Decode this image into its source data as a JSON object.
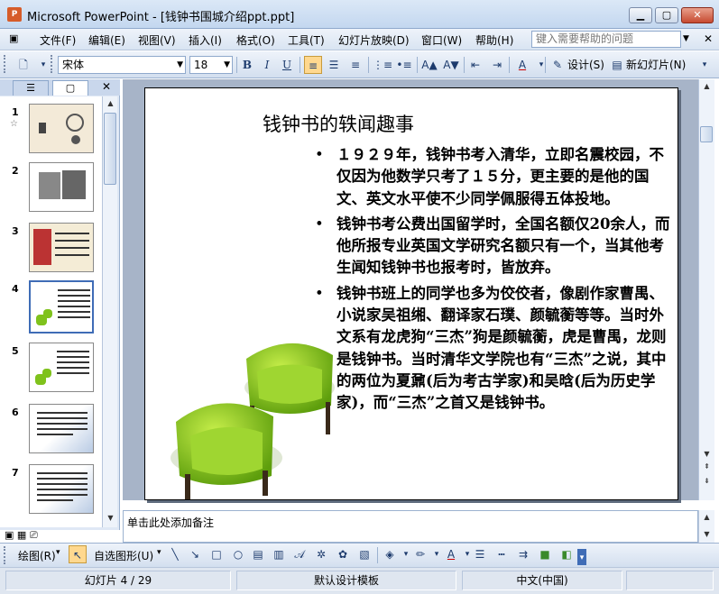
{
  "window": {
    "app_name": "Microsoft PowerPoint",
    "document": "[钱钟书围城介绍ppt.ppt]",
    "icon_label": "P"
  },
  "menu": {
    "items": [
      "文件(F)",
      "编辑(E)",
      "视图(V)",
      "插入(I)",
      "格式(O)",
      "工具(T)",
      "幻灯片放映(D)",
      "窗口(W)",
      "帮助(H)"
    ],
    "help_placeholder": "键入需要帮助的问题"
  },
  "toolbar": {
    "font_name": "宋体",
    "font_size": "18",
    "bold": "B",
    "italic": "I",
    "underline": "U",
    "design_label": "设计(S)",
    "new_slide_label": "新幻灯片(N)"
  },
  "slides_pane": {
    "thumbnails": [
      {
        "number": "1",
        "has_star": true
      },
      {
        "number": "2"
      },
      {
        "number": "3"
      },
      {
        "number": "4",
        "selected": true
      },
      {
        "number": "5"
      },
      {
        "number": "6"
      },
      {
        "number": "7"
      }
    ]
  },
  "slide": {
    "title": "钱钟书的轶闻趣事",
    "bullets": [
      "１９２９年，钱钟书考入清华，立即名震校园，不仅因为他数学只考了１５分，更主要的是他的国文、英文水平使不少同学佩服得五体投地。",
      "钱钟书考公费出国留学时，全国名额仅20余人，而他所报专业英国文学研究名额只有一个，当其他考生闻知钱钟书也报考时，皆放弃。",
      "钱钟书班上的同学也多为佼佼者，像剧作家曹禺、小说家吴祖缃、翻译家石璞、颜毓蘅等等。当时外文系有龙虎狗“三杰”狗是颜毓蘅，虎是曹禺，龙则是钱钟书。当时清华文学院也有“三杰”之说，其中的两位为夏鼐(后为考古学家)和吴晗(后为历史学家)，而“三杰”之首又是钱钟书。"
    ],
    "chair_color": "#7fc21c"
  },
  "notes": {
    "placeholder": "单击此处添加备注"
  },
  "drawing_toolbar": {
    "draw_label": "绘图(R)",
    "autoshapes_label": "自选图形(U)"
  },
  "status": {
    "slide_indicator": "幻灯片 4 / 29",
    "template": "默认设计模板",
    "language": "中文(中国)"
  },
  "colors": {
    "accent": "#3f6cb6",
    "highlight": "#ffd88f"
  }
}
